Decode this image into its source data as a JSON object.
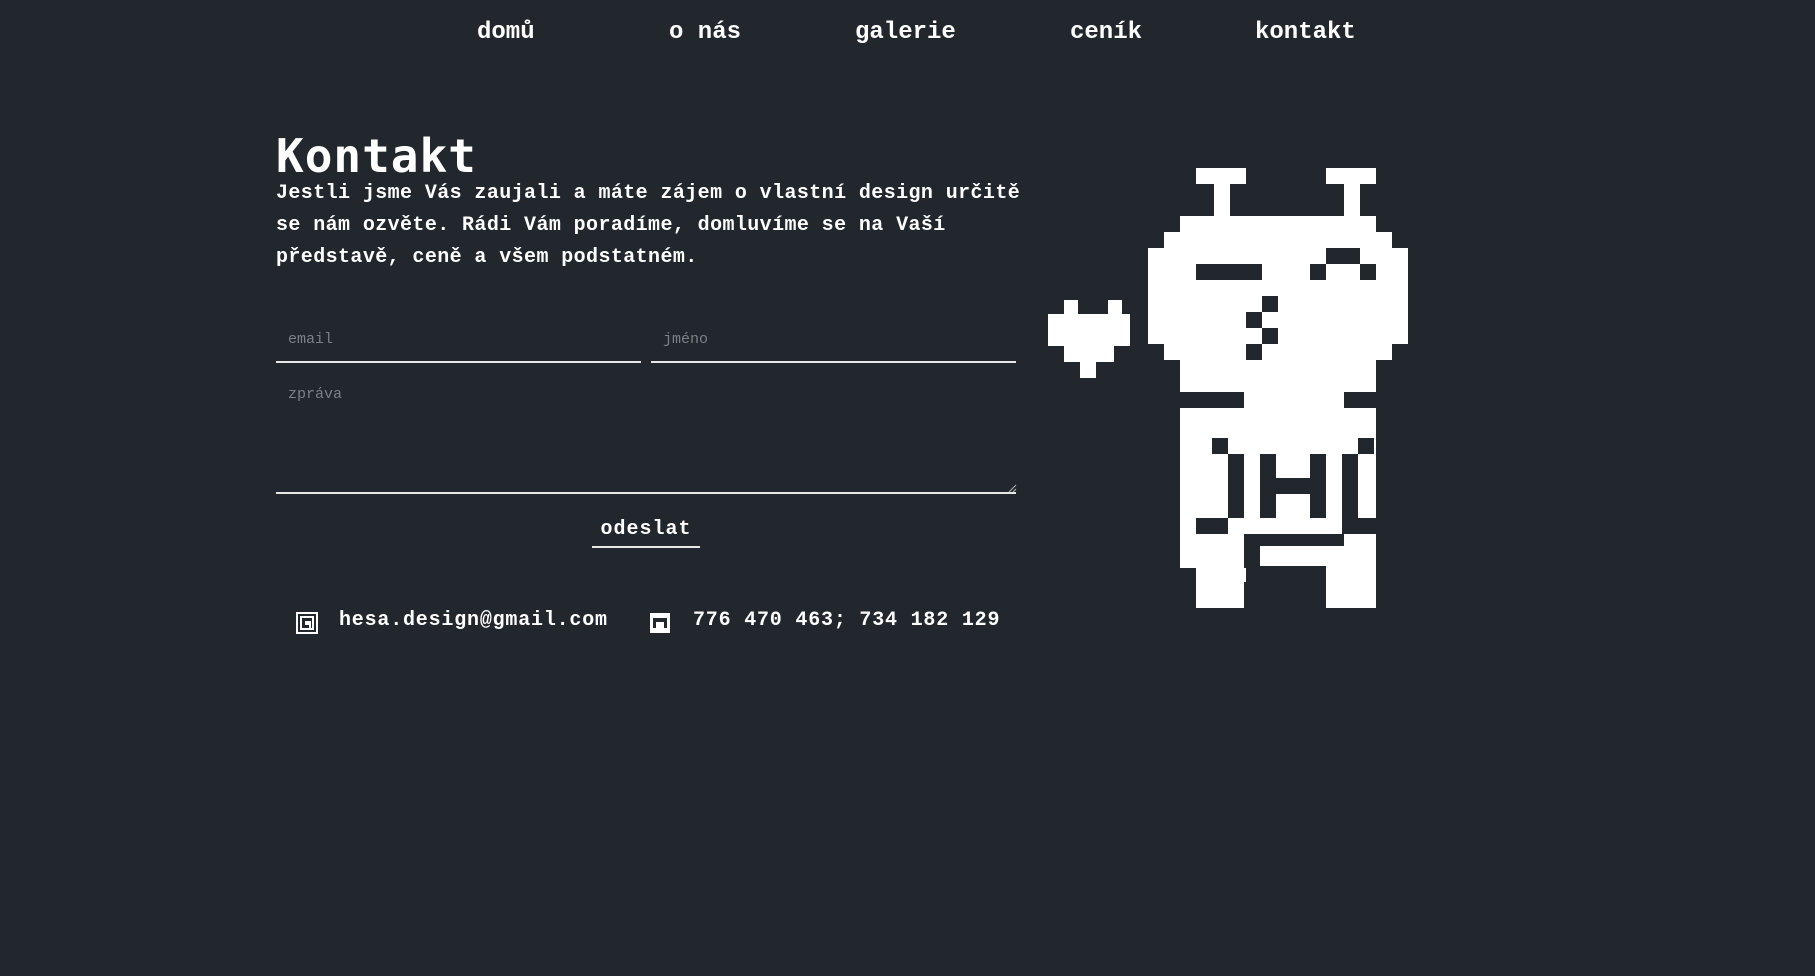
{
  "nav": {
    "home": "domů",
    "about": "o nás",
    "gallery": "galerie",
    "pricing": "ceník",
    "contact": "kontakt"
  },
  "page": {
    "title": "Kontakt",
    "intro": "Jestli jsme Vás zaujali a máte zájem o vlastní design určitě se nám ozvěte. Rádi Vám poradíme, domluvíme se na Vaší představě, ceně a všem podstatném."
  },
  "form": {
    "email_placeholder": "email",
    "name_placeholder": "jméno",
    "message_placeholder": "zpráva",
    "submit_label": "odeslat"
  },
  "contact_info": {
    "email": "hesa.design@gmail.com",
    "phones": "776 470 463; 734 182 129",
    "email_icon": "email-at-icon",
    "phone_icon": "phone-icon"
  },
  "colors": {
    "background": "#22262d",
    "text": "#ffffff",
    "placeholder": "#7b818b"
  }
}
